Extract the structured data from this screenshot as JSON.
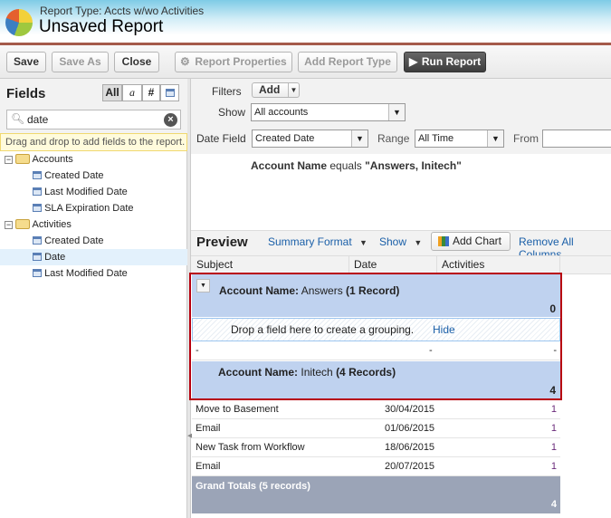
{
  "header": {
    "report_type": "Report Type: Accts w/wo Activities",
    "title": "Unsaved Report"
  },
  "toolbar": {
    "save": "Save",
    "save_as": "Save As",
    "close": "Close",
    "report_properties": "Report Properties",
    "add_report_type": "Add Report Type",
    "run_report": "Run Report"
  },
  "fields_panel": {
    "title": "Fields",
    "filters": [
      "All",
      "a",
      "#",
      "cal"
    ],
    "search_value": "date",
    "tip": "Drag and drop to add fields to the report.",
    "groups": [
      {
        "label": "Accounts",
        "items": [
          "Created Date",
          "Last Modified Date",
          "SLA Expiration Date"
        ]
      },
      {
        "label": "Activities",
        "items": [
          "Created Date",
          "Date",
          "Last Modified Date"
        ]
      }
    ],
    "selected": "Date"
  },
  "filters": {
    "filters_label": "Filters",
    "add": "Add",
    "show_label": "Show",
    "show_value": "All accounts",
    "date_field_label": "Date Field",
    "date_field_value": "Created Date",
    "range_label": "Range",
    "range_value": "All Time",
    "from_label": "From",
    "criteria_field": "Account Name",
    "criteria_op": "equals",
    "criteria_value": "\"Answers, Initech\""
  },
  "preview": {
    "title": "Preview",
    "summary_format": "Summary Format",
    "show": "Show",
    "add_chart": "Add Chart",
    "remove_all": "Remove All Columns",
    "columns": [
      "Subject",
      "Date",
      "Activities"
    ],
    "group1": {
      "label": "Account Name:",
      "value": "Answers",
      "count": "(1 Record)",
      "total": "0"
    },
    "drop_hint": "Drop a field here to create a grouping.",
    "hide": "Hide",
    "empty_row": [
      "-",
      "-",
      "-"
    ],
    "group2": {
      "label": "Account Name:",
      "value": "Initech",
      "count": "(4 Records)",
      "total": "4"
    },
    "rows": [
      [
        "Move to Basement",
        "30/04/2015",
        "1"
      ],
      [
        "Email",
        "01/06/2015",
        "1"
      ],
      [
        "New Task from Workflow",
        "18/06/2015",
        "1"
      ],
      [
        "Email",
        "20/07/2015",
        "1"
      ]
    ],
    "grand_totals": "Grand Totals (5 records)",
    "grand_total_value": "4"
  },
  "colors": {
    "group_bg": "#bfd2ef",
    "highlight_border": "#b8000f",
    "grand_total_bg": "#9ba4b7"
  }
}
